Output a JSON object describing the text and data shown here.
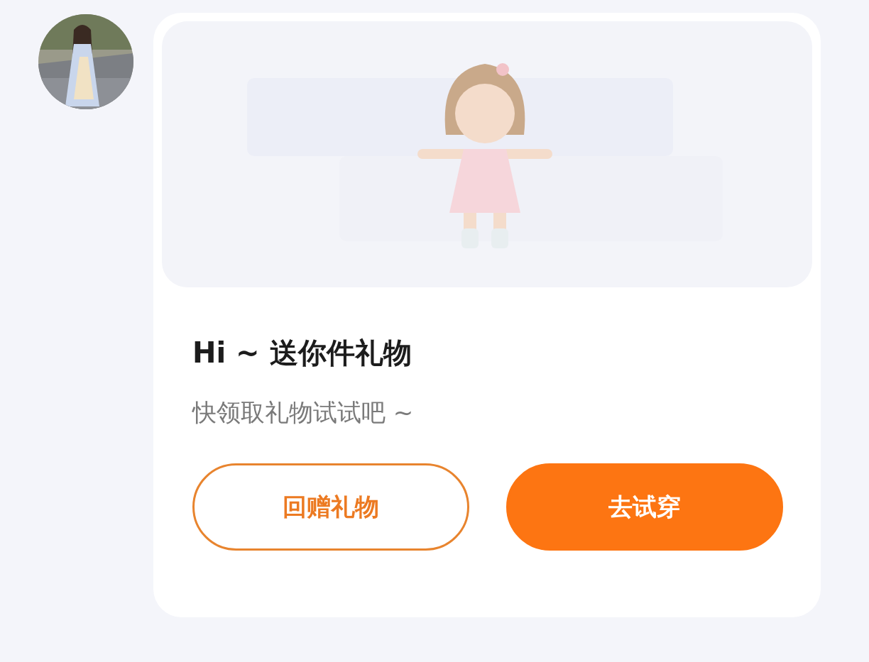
{
  "card": {
    "title": "Hi ~ 送你件礼物",
    "subtitle": "快领取礼物试试吧 ~",
    "buttons": [
      {
        "label": "回赠礼物",
        "kind": "outline"
      },
      {
        "label": "去试穿",
        "kind": "filled"
      }
    ]
  }
}
